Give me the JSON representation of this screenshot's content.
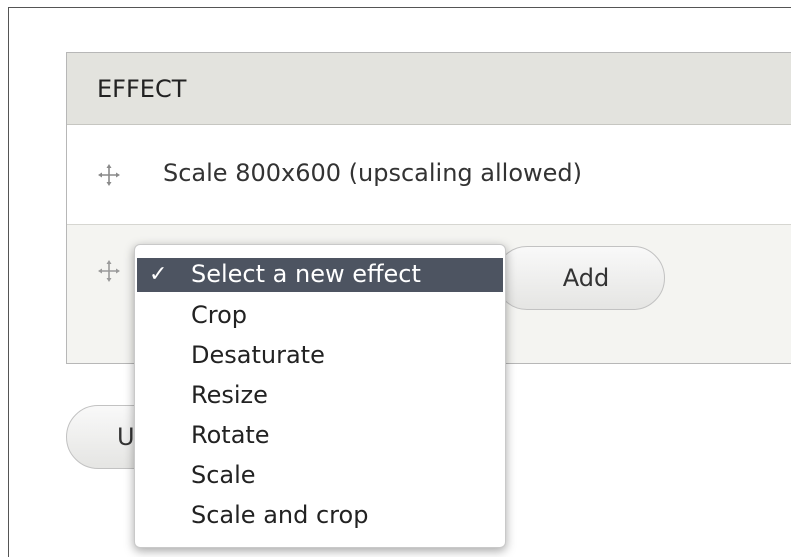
{
  "table": {
    "header": "EFFECT",
    "existing_effect": "Scale 800x600 (upscaling allowed)"
  },
  "select": {
    "selected": "Select a new effect",
    "check_glyph": "✓",
    "options": [
      "Crop",
      "Desaturate",
      "Resize",
      "Rotate",
      "Scale",
      "Scale and crop"
    ]
  },
  "buttons": {
    "add": "Add",
    "update_partial": "U"
  },
  "icons": {
    "drag": "drag-handle-icon"
  }
}
